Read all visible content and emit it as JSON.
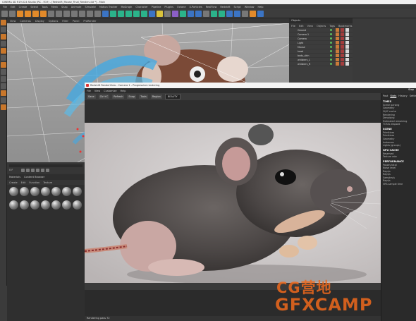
{
  "c4d": {
    "title": "CINEMA 4D R19.024 Studio (RC - R19) - [Redshift_Mouse_Final_Render.c4d *] - Main",
    "menus": [
      "File",
      "Edit",
      "Create",
      "Select",
      "Tools",
      "Mesh",
      "Snap",
      "Animate",
      "Simulate",
      "Motion Tracker",
      "MoGraph",
      "Character",
      "Pipeline",
      "Plugins",
      "Octane",
      "X-Particles",
      "RealFlow",
      "Redshift",
      "Script",
      "Window",
      "Help"
    ],
    "viewport_menu": [
      "View",
      "Cameras",
      "Display",
      "Options",
      "Filter",
      "Panel",
      "ProRender"
    ],
    "timeline_frame": "0 F",
    "material_tabs": [
      "Materials",
      "Content Browser"
    ],
    "material_menu": [
      "Create",
      "Edit",
      "Function",
      "Texture"
    ]
  },
  "objects_panel": {
    "title": "Objects",
    "menu": [
      "File",
      "Edit",
      "View",
      "Objects",
      "Tags",
      "Bookmarks"
    ],
    "items": [
      "Ground",
      "Camera.1",
      "Camera",
      "Light",
      "Mouse",
      "head",
      "body_skin",
      "whiskers_L",
      "whiskers_R"
    ]
  },
  "render_view": {
    "title": "Redshift RenderView - Camera 1 - Progressive rendering",
    "menu": [
      "File",
      "View",
      "Customize",
      "Help"
    ],
    "toolbar": {
      "save": "Save",
      "ctrl_c": "Ctrl+C",
      "refresh": "Refresh",
      "snap": "Snap",
      "tools": "Tools",
      "region": "Region",
      "beauty": "BEAUTY"
    },
    "stop": "Stop",
    "status": "Rendering pass 72"
  },
  "stats": {
    "tabs": [
      "Post",
      "Stats",
      "History",
      "Settings"
    ],
    "active_tab": "Stats",
    "sections": [
      {
        "head": "TIMES",
        "lines": [
          "Scene parsing",
          "Geometry",
          "GI/IC cache",
          "Rendering",
          "Denoising",
          "Estimated remaining",
          "TOTAL elapsed"
        ]
      },
      {
        "head": "SCENE",
        "lines": [
          "Primitives",
          "Primitives",
          "Geometry",
          "Instances",
          "Lights (groups)"
        ]
      },
      {
        "head": "GPU CACHE",
        "lines": [
          "Reserved",
          "Texture rate"
        ]
      },
      {
        "head": "PERFORMANCE",
        "lines": [
          "Passes total",
          "Noise level",
          "Rays/s",
          "Rays/s",
          "Samples/s",
          "Rays/s",
          "VRS sample time"
        ]
      }
    ]
  },
  "watermark": {
    "line1": "CG营地",
    "line2": "GFXCAMP"
  },
  "colors": {
    "accent": "#e28a2a",
    "watermark": "#ee681c"
  }
}
